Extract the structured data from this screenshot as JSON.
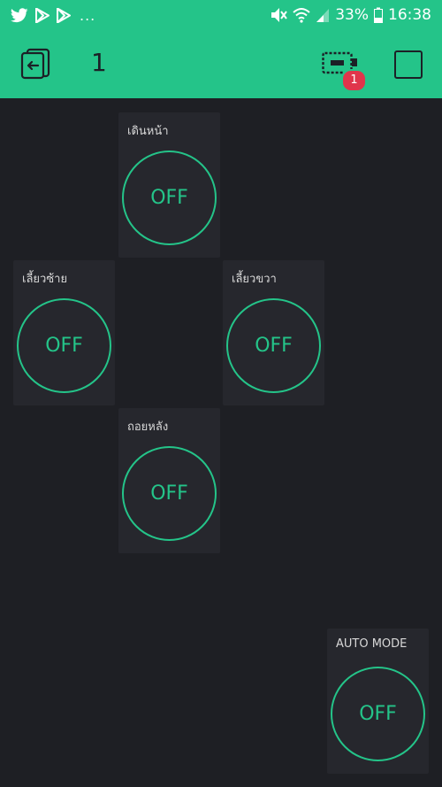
{
  "status_bar": {
    "notification_overflow": "...",
    "battery_percent": "33%",
    "time": "16:38",
    "icons": [
      "twitter-icon",
      "play-store-icon",
      "play-store-icon",
      "mute-icon",
      "wifi-icon",
      "signal-icon",
      "battery-icon"
    ]
  },
  "header": {
    "project_title": "1",
    "device_badge_count": "1",
    "icons": [
      "exit-project-icon",
      "device-icon",
      "stop-icon"
    ]
  },
  "widgets": {
    "forward": {
      "label": "เดินหน้า",
      "state": "OFF"
    },
    "turn_left": {
      "label": "เลี้ยวซ้าย",
      "state": "OFF"
    },
    "turn_right": {
      "label": "เลี้ยวขวา",
      "state": "OFF"
    },
    "backward": {
      "label": "ถอยหลัง",
      "state": "OFF"
    },
    "auto_mode": {
      "label": "AUTO MODE",
      "state": "OFF"
    }
  },
  "colors": {
    "accent": "#24c489",
    "background": "#1e1f24",
    "widget_background": "#26272d",
    "badge": "#e0354b",
    "header_icon": "#1c2026"
  }
}
